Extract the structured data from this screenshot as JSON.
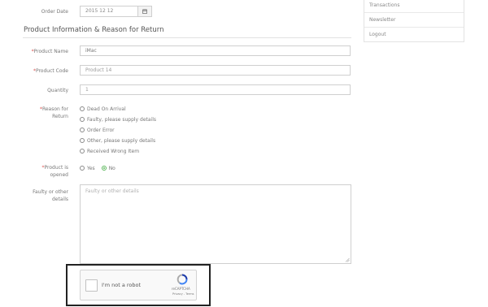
{
  "order_date": {
    "label": "Order Date",
    "value": "2015 12 12"
  },
  "section_title": "Product Information & Reason for Return",
  "product_name": {
    "label": "Product Name",
    "value": "iMac"
  },
  "product_code": {
    "label": "Product Code",
    "value": "Product 14"
  },
  "quantity": {
    "label": "Quantity",
    "value": "1"
  },
  "reason": {
    "label_line1": "Reason for",
    "label_line2": "Return",
    "options": [
      "Dead On Arrival",
      "Faulty, please supply details",
      "Order Error",
      "Other, please supply details",
      "Received Wrong Item"
    ]
  },
  "opened": {
    "label_line1": "Product is",
    "label_line2": "opened",
    "options": [
      "Yes",
      "No"
    ],
    "selected": "No"
  },
  "details": {
    "label_line1": "Faulty or other",
    "label_line2": "details",
    "placeholder": "Faulty or other details"
  },
  "captcha": {
    "label": "I'm not a robot",
    "brand": "reCAPTCHA",
    "links": "Privacy - Terms"
  },
  "sidebar": {
    "items": [
      "Transactions",
      "Newsletter",
      "Logout"
    ]
  },
  "required_marker": "*",
  "colors": {
    "required": "#d9534f",
    "radio_selected": "#5cb85c",
    "border": "#cfcfcf"
  }
}
